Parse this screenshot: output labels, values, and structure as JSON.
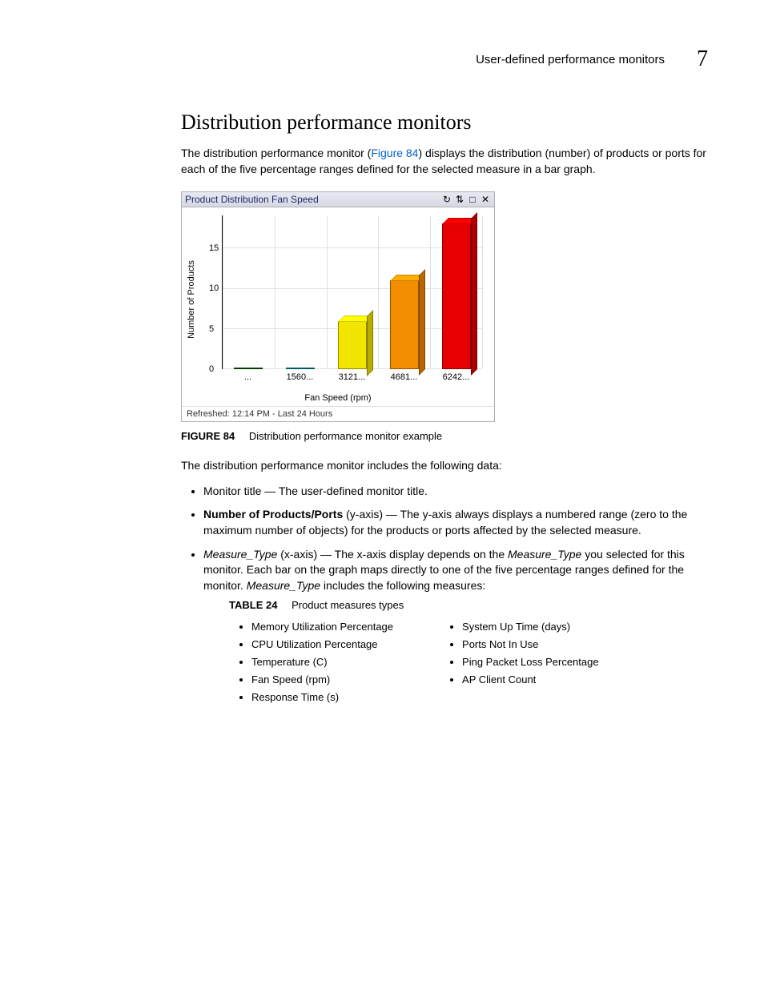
{
  "header": {
    "running_title": "User-defined performance monitors",
    "chapter_number": "7"
  },
  "section": {
    "title": "Distribution performance monitors",
    "intro_pre": "The distribution performance monitor (",
    "intro_link": "Figure 84",
    "intro_post": ") displays the distribution (number) of products or ports for each of the five percentage ranges defined for the selected measure in a bar graph."
  },
  "widget": {
    "title": "Product Distribution Fan Speed",
    "ylabel": "Number of Products",
    "xlabel": "Fan Speed (rpm)",
    "footer": "Refreshed: 12:14 PM -  Last 24 Hours"
  },
  "chart_data": {
    "type": "bar",
    "categories": [
      "...",
      "1560...",
      "3121...",
      "4681...",
      "6242..."
    ],
    "values": [
      0,
      0,
      6,
      11,
      18
    ],
    "colors": [
      "#008000",
      "#00b7c3",
      "#f2e600",
      "#f28c00",
      "#e60000"
    ],
    "yticks": [
      0,
      5,
      10,
      15
    ],
    "ylim": [
      0,
      19
    ],
    "title": "Product Distribution Fan Speed",
    "xlabel": "Fan Speed (rpm)",
    "ylabel": "Number of Products"
  },
  "figure_caption": {
    "label": "FIGURE 84",
    "text": "Distribution performance monitor example"
  },
  "after_figure_para": "The distribution performance monitor includes the following data:",
  "bullets": {
    "b1": "Monitor title — The user-defined monitor title.",
    "b2_bold": "Number of Products/Ports",
    "b2_rest": " (y-axis) — The y-axis always displays a numbered range (zero to the maximum number of objects) for the products or ports affected by the selected measure.",
    "b3_i1": "Measure_Type",
    "b3_t1": " (x-axis) — The x-axis display depends on the ",
    "b3_i2": "Measure_Type",
    "b3_t2": " you selected for this monitor. Each bar on the graph maps directly to one of the five percentage ranges defined for the monitor. ",
    "b3_i3": "Measure_Type",
    "b3_t3": " includes the following measures:"
  },
  "table_caption": {
    "label": "TABLE 24",
    "text": "Product measures types"
  },
  "measures_left": [
    "Memory Utilization Percentage",
    "CPU Utilization Percentage",
    "Temperature (C)",
    "Fan Speed (rpm)",
    "Response Time (s)"
  ],
  "measures_right": [
    "System Up Time (days)",
    "Ports Not In Use",
    "Ping Packet Loss Percentage",
    "AP Client Count"
  ]
}
